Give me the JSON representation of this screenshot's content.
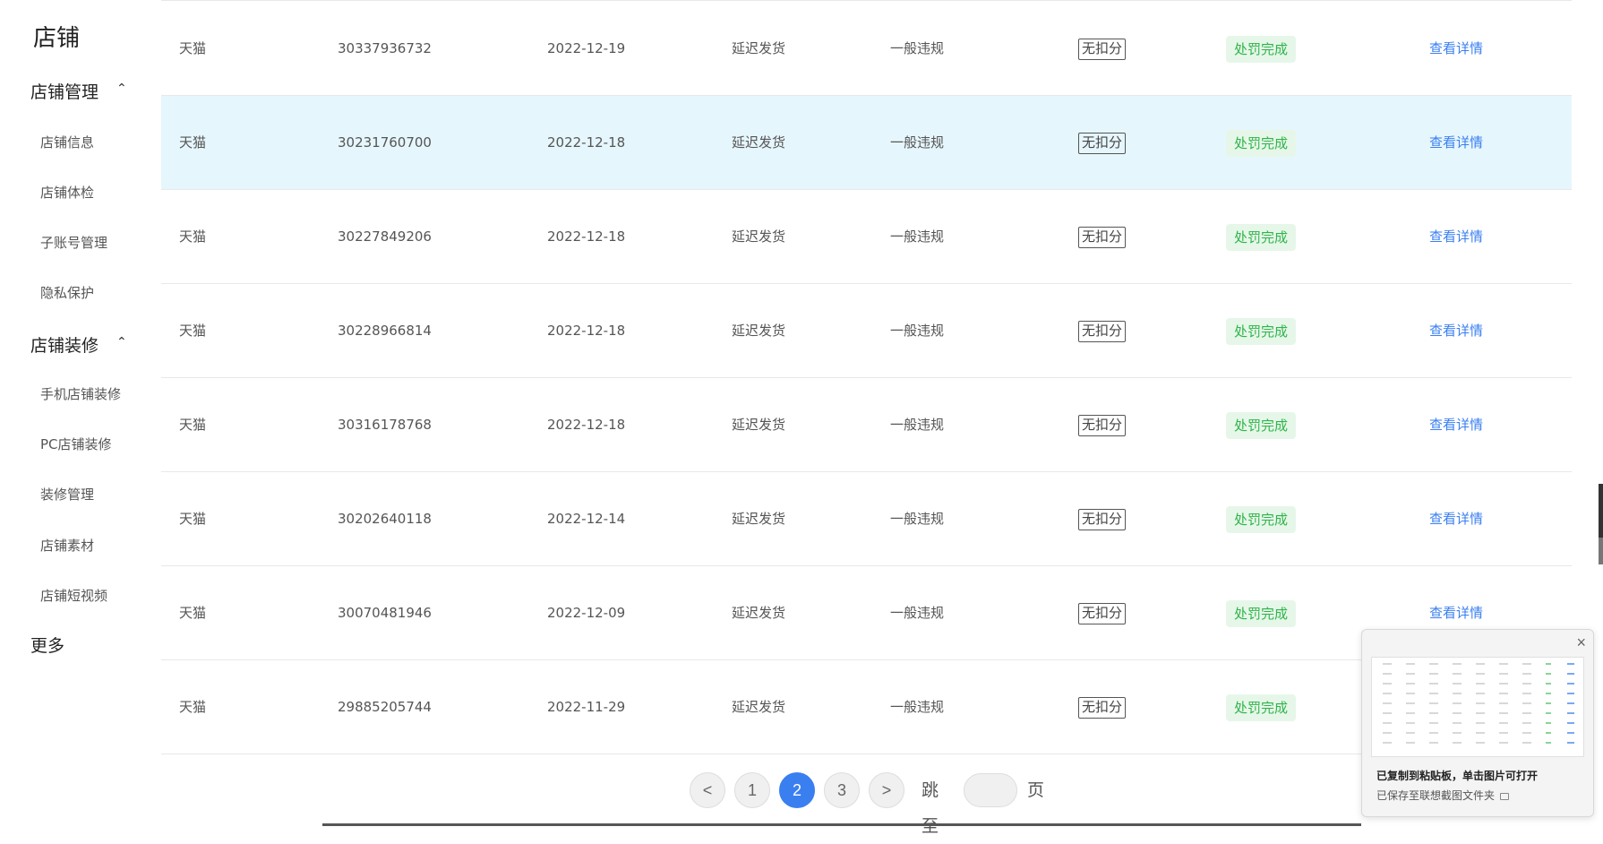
{
  "sidebar": {
    "title": "店铺",
    "groups": [
      {
        "label": "店铺管理",
        "items": [
          "店铺信息",
          "店铺体检",
          "子账号管理",
          "隐私保护"
        ]
      },
      {
        "label": "店铺装修",
        "items": [
          "手机店铺装修",
          "PC店铺装修",
          "装修管理",
          "店铺素材",
          "店铺短视频"
        ]
      }
    ],
    "more": "更多"
  },
  "table": {
    "rows": [
      {
        "platform": "天猫",
        "id": "30337936732",
        "date": "2022-12-19",
        "type": "延迟发货",
        "level": "一般违规",
        "score": "无扣分",
        "status": "处罚完成",
        "action": "查看详情"
      },
      {
        "platform": "天猫",
        "id": "30231760700",
        "date": "2022-12-18",
        "type": "延迟发货",
        "level": "一般违规",
        "score": "无扣分",
        "status": "处罚完成",
        "action": "查看详情"
      },
      {
        "platform": "天猫",
        "id": "30227849206",
        "date": "2022-12-18",
        "type": "延迟发货",
        "level": "一般违规",
        "score": "无扣分",
        "status": "处罚完成",
        "action": "查看详情"
      },
      {
        "platform": "天猫",
        "id": "30228966814",
        "date": "2022-12-18",
        "type": "延迟发货",
        "level": "一般违规",
        "score": "无扣分",
        "status": "处罚完成",
        "action": "查看详情"
      },
      {
        "platform": "天猫",
        "id": "30316178768",
        "date": "2022-12-18",
        "type": "延迟发货",
        "level": "一般违规",
        "score": "无扣分",
        "status": "处罚完成",
        "action": "查看详情"
      },
      {
        "platform": "天猫",
        "id": "30202640118",
        "date": "2022-12-14",
        "type": "延迟发货",
        "level": "一般违规",
        "score": "无扣分",
        "status": "处罚完成",
        "action": "查看详情"
      },
      {
        "platform": "天猫",
        "id": "30070481946",
        "date": "2022-12-09",
        "type": "延迟发货",
        "level": "一般违规",
        "score": "无扣分",
        "status": "处罚完成",
        "action": "查看详情"
      },
      {
        "platform": "天猫",
        "id": "29885205744",
        "date": "2022-11-29",
        "type": "延迟发货",
        "level": "一般违规",
        "score": "无扣分",
        "status": "处罚完成",
        "action": ""
      }
    ]
  },
  "pagination": {
    "prev": "<",
    "pages": [
      "1",
      "2",
      "3"
    ],
    "current": "2",
    "next": ">",
    "jump_label": "跳至",
    "page_suffix": "页"
  },
  "toast": {
    "title": "已复制到粘贴板，单击图片可打开",
    "subtitle": "已保存至联想截图文件夹",
    "close": "×"
  },
  "colors": {
    "accent": "#3a7ff0",
    "status_green": "#2fb44a",
    "status_bg": "#e6f7e9",
    "highlight_row": "#e6f6fd"
  }
}
